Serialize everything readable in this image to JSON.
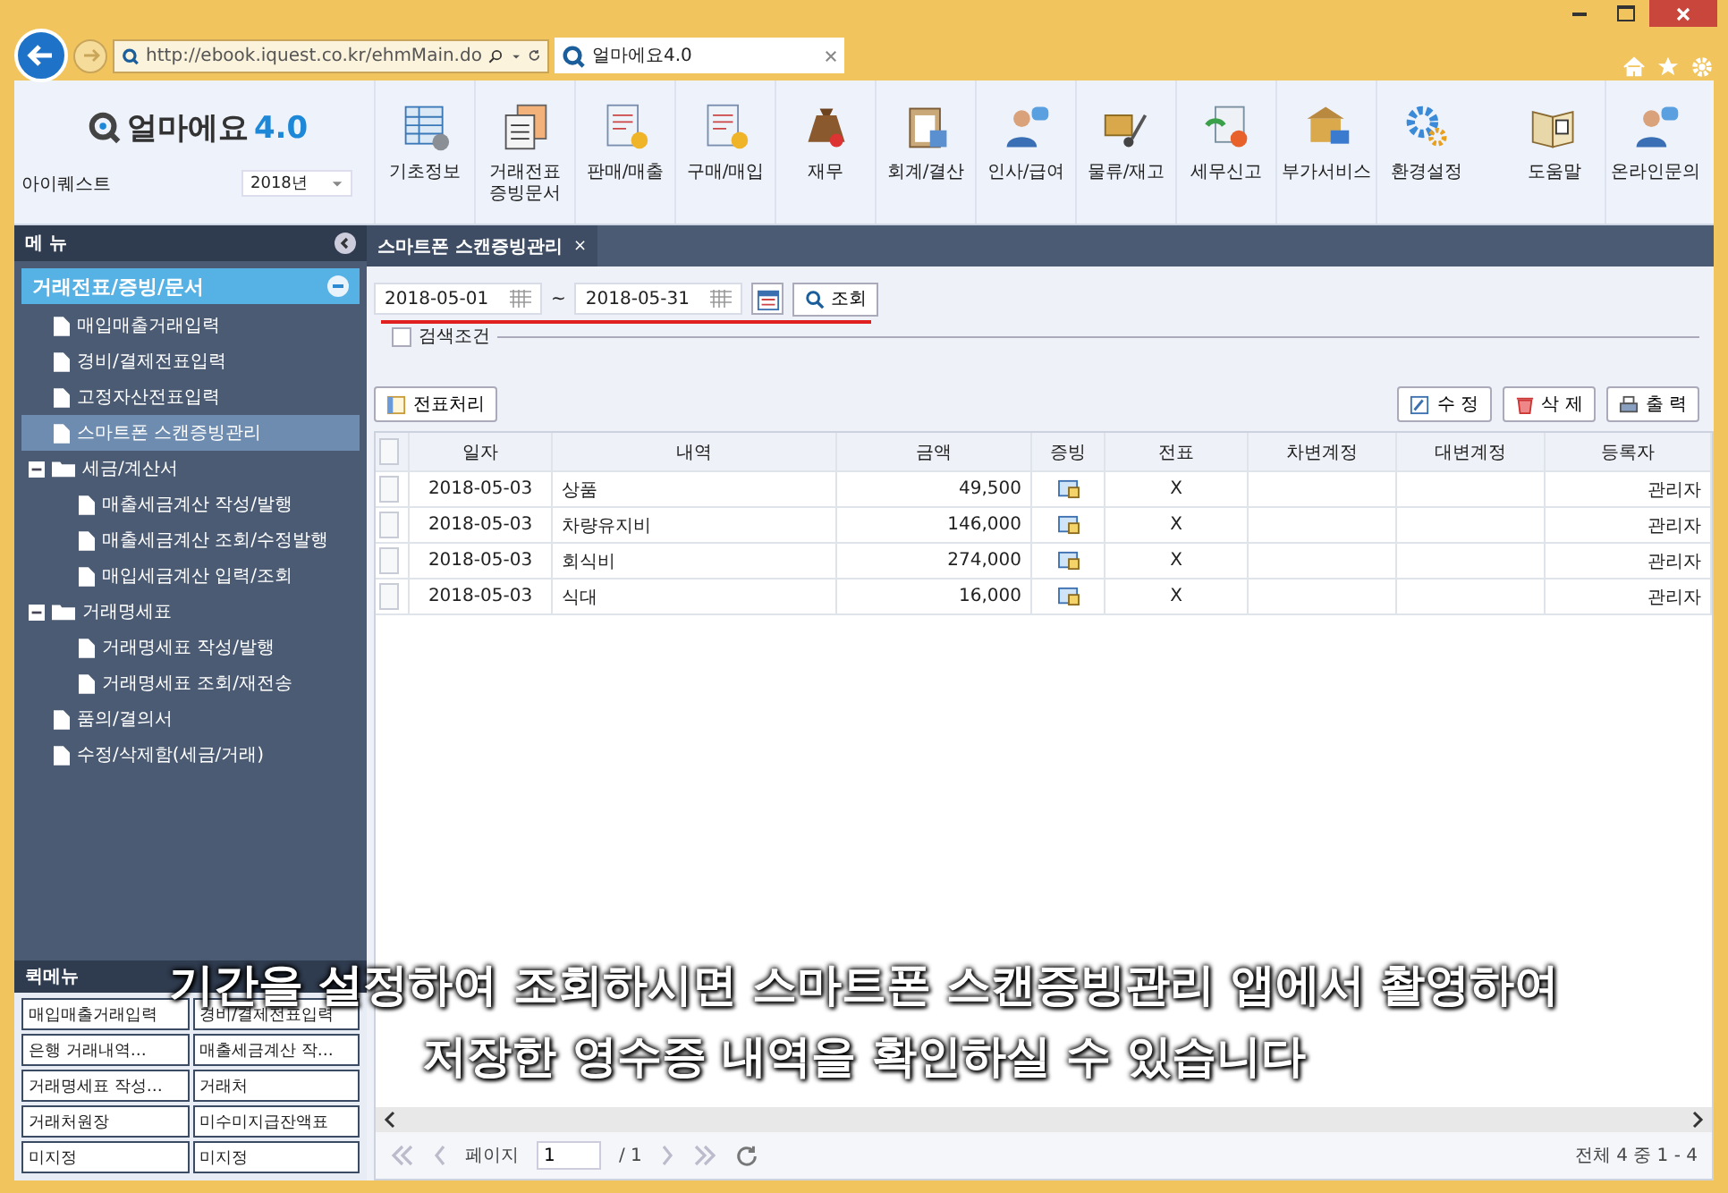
{
  "browser": {
    "address": "http://ebook.iquest.co.kr/ehmMain.do",
    "tab_title": "얼마에요4.0"
  },
  "app": {
    "logo_text": "얼마에요",
    "logo_version": "4.0",
    "company": "아이퀘스트",
    "year": "2018년"
  },
  "toolbar": [
    {
      "label": "기초정보"
    },
    {
      "label": "거래전표\n증빙문서"
    },
    {
      "label": "판매/매출"
    },
    {
      "label": "구매/매입"
    },
    {
      "label": "재무"
    },
    {
      "label": "회계/결산"
    },
    {
      "label": "인사/급여"
    },
    {
      "label": "물류/재고"
    },
    {
      "label": "세무신고"
    },
    {
      "label": "부가서비스"
    },
    {
      "label": "환경설정"
    },
    {
      "label": "도움말"
    },
    {
      "label": "온라인문의"
    }
  ],
  "sidebar": {
    "title": "메 뉴",
    "group": {
      "label": "거래전표/증빙/문서",
      "expanded": true,
      "children": [
        {
          "kind": "leaf",
          "label": "매입매출거래입력",
          "selected": false
        },
        {
          "kind": "leaf",
          "label": "경비/결제전표입력",
          "selected": false
        },
        {
          "kind": "leaf",
          "label": "고정자산전표입력",
          "selected": false
        },
        {
          "kind": "leaf",
          "label": "스마트폰 스캔증빙관리",
          "selected": true
        },
        {
          "kind": "folder",
          "label": "세금/계산서",
          "expanded": true,
          "selected": false,
          "children": [
            {
              "kind": "leaf",
              "label": "매출세금계산 작성/발행",
              "selected": false
            },
            {
              "kind": "leaf",
              "label": "매출세금계산 조회/수정발행",
              "selected": false
            },
            {
              "kind": "leaf",
              "label": "매입세금계산 입력/조회",
              "selected": false
            }
          ]
        },
        {
          "kind": "folder",
          "label": "거래명세표",
          "expanded": true,
          "selected": false,
          "children": [
            {
              "kind": "leaf",
              "label": "거래명세표 작성/발행",
              "selected": false
            },
            {
              "kind": "leaf",
              "label": "거래명세표 조회/재전송",
              "selected": false
            }
          ]
        },
        {
          "kind": "leaf",
          "label": "품의/결의서",
          "selected": false
        },
        {
          "kind": "leaf",
          "label": "수정/삭제함(세금/거래)",
          "selected": false
        }
      ]
    }
  },
  "quick_menu": {
    "title": "퀵메뉴",
    "items": [
      "매입매출거래입력",
      "경비/결제전표입력",
      "은행 거래내역…",
      "매출세금계산 작…",
      "거래명세표 작성…",
      "거래처",
      "거래처원장",
      "미수미지급잔액표",
      "미지정",
      "미지정"
    ]
  },
  "content_tab": {
    "label": "스마트폰 스캔증빙관리",
    "close": "×"
  },
  "search": {
    "date_from": "2018-05-01",
    "separator": "~",
    "date_to": "2018-05-31",
    "search_button": "조회",
    "condition_label": "검색조건",
    "condition_checked": false
  },
  "actions": {
    "left": "전표처리",
    "right": [
      "수 정",
      "삭 제",
      "출 력"
    ]
  },
  "table": {
    "select_all_checked": false,
    "columns": [
      "일자",
      "내역",
      "금액",
      "증빙",
      "전표",
      "차변계정",
      "대변계정",
      "등록자"
    ],
    "rows": [
      {
        "date": "2018-05-03",
        "description": "상품",
        "amount": "49,500",
        "voucher": "X",
        "debit": "",
        "credit": "",
        "registrant": "관리자",
        "checked": false
      },
      {
        "date": "2018-05-03",
        "description": "차량유지비",
        "amount": "146,000",
        "voucher": "X",
        "debit": "",
        "credit": "",
        "registrant": "관리자",
        "checked": false
      },
      {
        "date": "2018-05-03",
        "description": "회식비",
        "amount": "274,000",
        "voucher": "X",
        "debit": "",
        "credit": "",
        "registrant": "관리자",
        "checked": false
      },
      {
        "date": "2018-05-03",
        "description": "식대",
        "amount": "16,000",
        "voucher": "X",
        "debit": "",
        "credit": "",
        "registrant": "관리자",
        "checked": false
      }
    ]
  },
  "pager": {
    "page_label": "페이지",
    "page": "1",
    "total_pages": "/ 1",
    "summary": "전체 4 중 1 - 4"
  },
  "subtitle": [
    "기간을 설정하여 조회하시면 스마트폰 스캔증빙관리 앱에서 촬영하여",
    "저장한 영수증 내역을 확인하실 수 있습니다"
  ]
}
